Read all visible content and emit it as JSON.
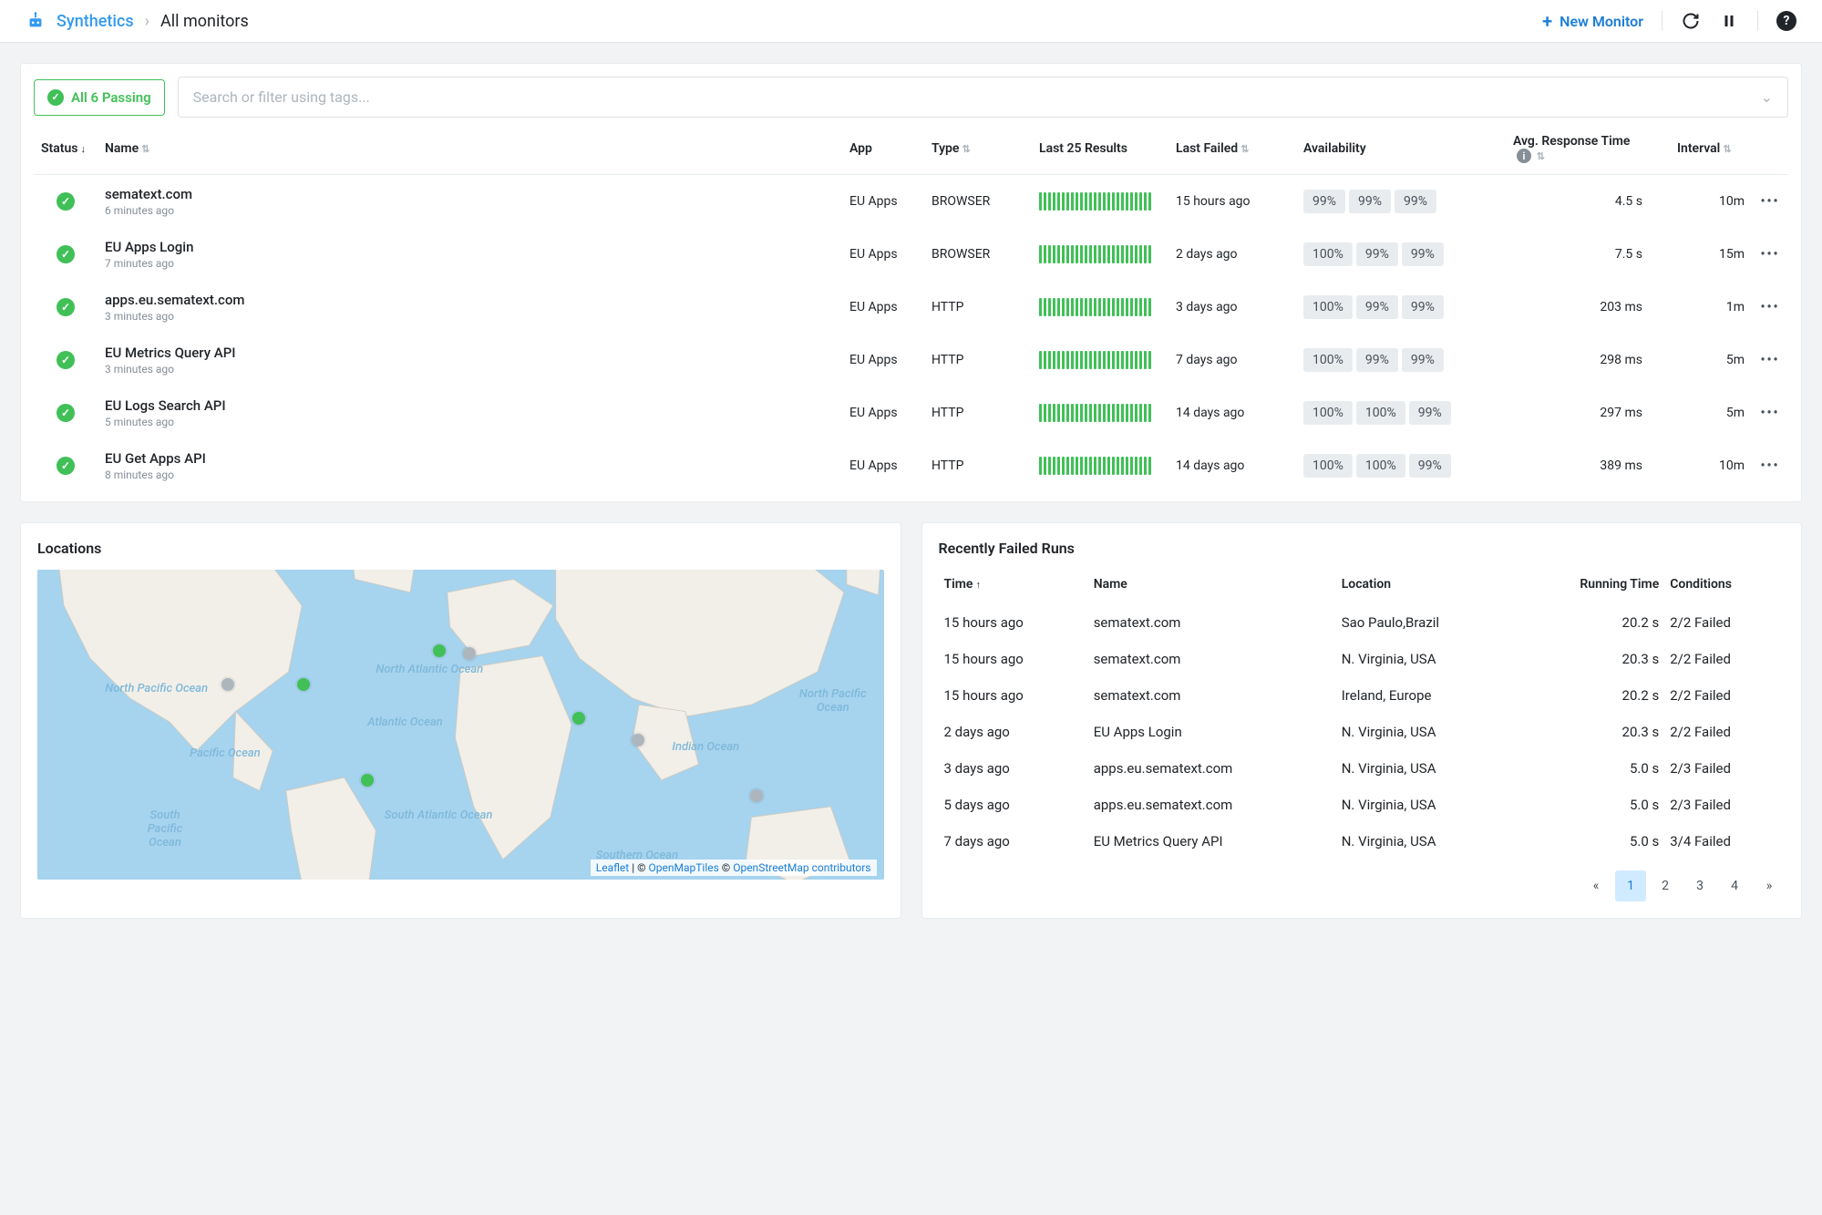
{
  "header": {
    "breadcrumb_root": "Synthetics",
    "breadcrumb_current": "All monitors",
    "new_monitor_label": "New Monitor"
  },
  "filters": {
    "passing_label": "All 6 Passing",
    "search_placeholder": "Search or filter using tags..."
  },
  "columns": {
    "status": "Status",
    "name": "Name",
    "app": "App",
    "type": "Type",
    "last_results": "Last 25 Results",
    "last_failed": "Last Failed",
    "availability": "Availability",
    "avg_response": "Avg. Response Time",
    "interval": "Interval"
  },
  "monitors": [
    {
      "name": "sematext.com",
      "ago": "6 minutes ago",
      "app": "EU Apps",
      "type": "BROWSER",
      "last_failed": "15 hours ago",
      "avail": [
        "99%",
        "99%",
        "99%"
      ],
      "resp": "4.5 s",
      "interval": "10m"
    },
    {
      "name": "EU Apps Login",
      "ago": "7 minutes ago",
      "app": "EU Apps",
      "type": "BROWSER",
      "last_failed": "2 days ago",
      "avail": [
        "100%",
        "99%",
        "99%"
      ],
      "resp": "7.5 s",
      "interval": "15m"
    },
    {
      "name": "apps.eu.sematext.com",
      "ago": "3 minutes ago",
      "app": "EU Apps",
      "type": "HTTP",
      "last_failed": "3 days ago",
      "avail": [
        "100%",
        "99%",
        "99%"
      ],
      "resp": "203 ms",
      "interval": "1m"
    },
    {
      "name": "EU Metrics Query API",
      "ago": "3 minutes ago",
      "app": "EU Apps",
      "type": "HTTP",
      "last_failed": "7 days ago",
      "avail": [
        "100%",
        "99%",
        "99%"
      ],
      "resp": "298 ms",
      "interval": "5m"
    },
    {
      "name": "EU Logs Search API",
      "ago": "5 minutes ago",
      "app": "EU Apps",
      "type": "HTTP",
      "last_failed": "14 days ago",
      "avail": [
        "100%",
        "100%",
        "99%"
      ],
      "resp": "297 ms",
      "interval": "5m"
    },
    {
      "name": "EU Get Apps API",
      "ago": "8 minutes ago",
      "app": "EU Apps",
      "type": "HTTP",
      "last_failed": "14 days ago",
      "avail": [
        "100%",
        "100%",
        "99%"
      ],
      "resp": "389 ms",
      "interval": "10m"
    }
  ],
  "locations": {
    "title": "Locations",
    "attrib_leaflet": "Leaflet",
    "attrib_sep1": " | © ",
    "attrib_omt": "OpenMapTiles",
    "attrib_sep2": " © ",
    "attrib_osm": "OpenStreetMap contributors",
    "water_labels": {
      "north_atlantic": "North Atlantic Ocean",
      "atlantic": "Atlantic Ocean",
      "pacific": "Pacific Ocean",
      "south_atlantic": "South Atlantic Ocean",
      "indian": "Indian Ocean",
      "southern": "Southern Ocean",
      "north_pacific": "North Pacific Ocean"
    }
  },
  "failed": {
    "title": "Recently Failed Runs",
    "cols": {
      "time": "Time",
      "name": "Name",
      "location": "Location",
      "running_time": "Running Time",
      "conditions": "Conditions"
    },
    "rows": [
      {
        "time": "15 hours ago",
        "name": "sematext.com",
        "location": "Sao Paulo,Brazil",
        "rt": "20.2 s",
        "cond": "2/2 Failed"
      },
      {
        "time": "15 hours ago",
        "name": "sematext.com",
        "location": "N. Virginia, USA",
        "rt": "20.3 s",
        "cond": "2/2 Failed"
      },
      {
        "time": "15 hours ago",
        "name": "sematext.com",
        "location": "Ireland, Europe",
        "rt": "20.2 s",
        "cond": "2/2 Failed"
      },
      {
        "time": "2 days ago",
        "name": "EU Apps Login",
        "location": "N. Virginia, USA",
        "rt": "20.3 s",
        "cond": "2/2 Failed"
      },
      {
        "time": "3 days ago",
        "name": "apps.eu.sematext.com",
        "location": "N. Virginia, USA",
        "rt": "5.0 s",
        "cond": "2/3 Failed"
      },
      {
        "time": "5 days ago",
        "name": "apps.eu.sematext.com",
        "location": "N. Virginia, USA",
        "rt": "5.0 s",
        "cond": "2/3 Failed"
      },
      {
        "time": "7 days ago",
        "name": "EU Metrics Query API",
        "location": "N. Virginia, USA",
        "rt": "5.0 s",
        "cond": "3/4 Failed"
      }
    ],
    "pages": [
      "«",
      "1",
      "2",
      "3",
      "4",
      "»"
    ],
    "active_page": "1"
  }
}
